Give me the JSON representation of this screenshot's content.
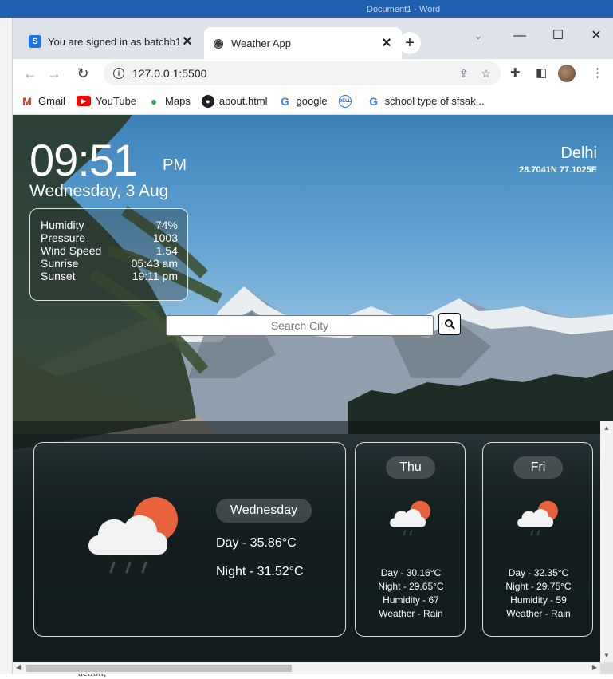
{
  "background": {
    "word_title": "Document1 - Word",
    "below_text": "action;"
  },
  "browser": {
    "tabs": [
      {
        "favicon": "S",
        "title": "You are signed in as batchb1",
        "close": "✕"
      },
      {
        "favicon": "◉",
        "title": "Weather App",
        "close": "✕"
      }
    ],
    "new_tab": "+",
    "window_controls": {
      "tab_search": "⌄",
      "minimize": "—",
      "maximize": "☐",
      "close": "✕"
    },
    "nav": {
      "back": "←",
      "forward": "→",
      "reload": "↻"
    },
    "url": "127.0.0.1:5500",
    "bookmarks": [
      {
        "icon": "M",
        "label": "Gmail"
      },
      {
        "icon": "▶",
        "label": "YouTube"
      },
      {
        "icon": "●",
        "label": "Maps"
      },
      {
        "icon": "●",
        "label": "about.html"
      },
      {
        "icon": "G",
        "label": "google"
      },
      {
        "icon": "DELL",
        "label": ""
      },
      {
        "icon": "G",
        "label": "school type of sfsak..."
      }
    ],
    "accent_color": "#1a73e8"
  },
  "weather": {
    "time": "09:51",
    "am_pm": "PM",
    "date": "Wednesday, 3 Aug",
    "details": [
      {
        "label": "Humidity",
        "value": "74%"
      },
      {
        "label": "Pressure",
        "value": "1003"
      },
      {
        "label": "Wind Speed",
        "value": "1.54"
      },
      {
        "label": "Sunrise",
        "value": "05:43 am"
      },
      {
        "label": "Sunset",
        "value": "19:11 pm"
      }
    ],
    "city": "Delhi",
    "coords": "28.7041N 77.1025E",
    "search_placeholder": "Search City",
    "today": {
      "day": "Wednesday",
      "day_temp": "Day - 35.86°C",
      "night_temp": "Night - 31.52°C",
      "icon": "cloud-rain-sun-icon"
    },
    "forecast": [
      {
        "day": "Thu",
        "day_temp": "Day - 30.16°C",
        "night_temp": "Night - 29.65°C",
        "humidity": "Humidity - 67",
        "weather": "Weather - Rain",
        "icon": "cloud-rain-sun-icon"
      },
      {
        "day": "Fri",
        "day_temp": "Day - 32.35°C",
        "night_temp": "Night - 29.75°C",
        "humidity": "Humidity - 59",
        "weather": "Weather - Rain",
        "icon": "cloud-rain-sun-icon"
      }
    ],
    "sun_color": "#e8633c"
  }
}
